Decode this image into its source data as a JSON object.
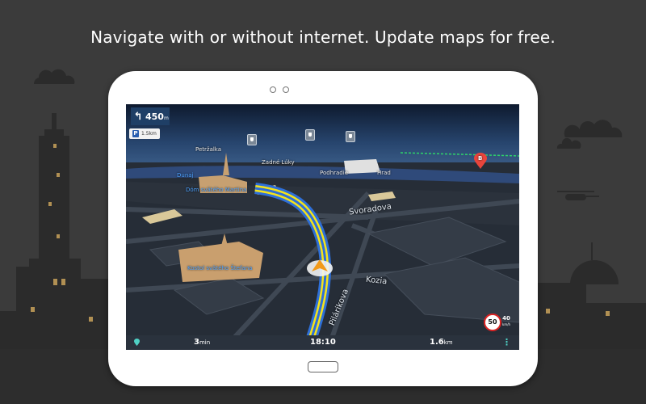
{
  "headline": "Navigate with or without internet. Update maps for free.",
  "colors": {
    "background": "#3b3b3b",
    "route_blue": "#2e6fd8",
    "route_yellow": "#f5e31a",
    "destination_red": "#e8453c",
    "bottombar": "#2a323d"
  },
  "navigation": {
    "turn_arrow_icon": "turn-left-arrow-icon",
    "distance_value": "450",
    "distance_unit": "m",
    "parking_distance": "1.5km",
    "speed_limit": "50",
    "current_speed": "40",
    "current_speed_unit": "km/h"
  },
  "map_labels": {
    "petrzalka": "Petržalka",
    "zadne_luky": "Zadné Lúky",
    "dunaj": "Dunaj",
    "podhradie": "Podhradie",
    "hrad": "Hrad",
    "dom": "Dóm svätého Martina",
    "svoradova": "Svoradova",
    "kostol": "Kostol svätého Štefana",
    "kozia": "Kozia",
    "pilarikova": "Pilárikova",
    "destination": "B"
  },
  "bottombar": {
    "time_remaining_value": "3",
    "time_remaining_unit": "min",
    "arrival_time": "18:10",
    "distance_remaining_value": "1.6",
    "distance_remaining_unit": "km"
  }
}
